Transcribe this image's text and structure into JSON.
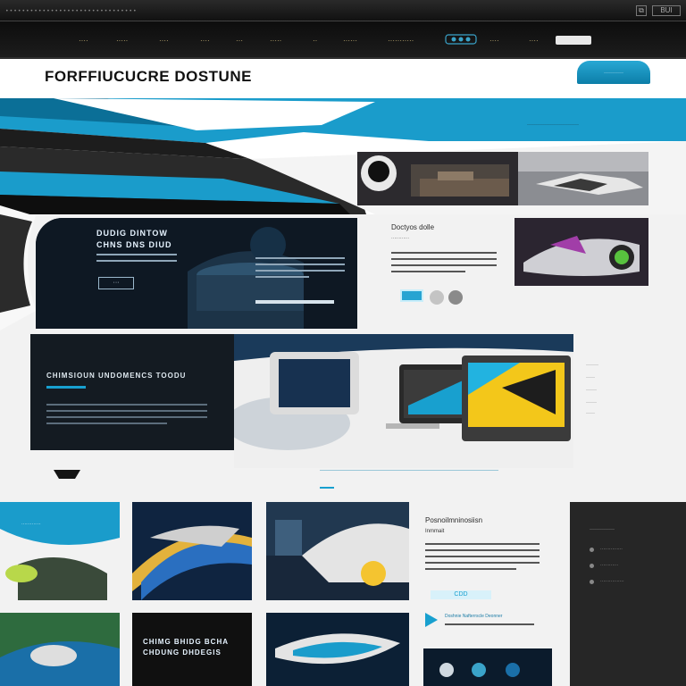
{
  "browser": {
    "url_text": "••••••••••••••••••••••••••••••••",
    "tool_left": "⧉",
    "tool_right": "BUI"
  },
  "nav": {
    "items": [
      "····",
      "·····",
      "····",
      "····",
      "···",
      "·····",
      "··",
      "······",
      "···········",
      "····",
      "····",
      "··"
    ]
  },
  "header": {
    "logo": "FORFFIUCUCRE DOSTUNE",
    "cta_label": "···········"
  },
  "hero": {
    "tagline": "·····························"
  },
  "feature": {
    "title_line1": "DUDIG DINTOW",
    "title_line2": "CHNS DNS DIUD",
    "button_label": "···",
    "side_title": "Doctyos dolle",
    "side_sub": "············"
  },
  "showcase": {
    "title": "CHIMSIOUN UNDOMENCS TOODU",
    "side_labels": [
      "·······",
      "·····",
      "······",
      "······",
      "·····"
    ]
  },
  "gallery": {
    "tile1_caption": "·············",
    "tile5_caption_line1": "CHIMG BHIDG BCHA",
    "tile5_caption_line2": "CHDUNG DHDEGIS"
  },
  "article": {
    "title": "Posnoilmninosiisn",
    "subtitle": "Inmmait",
    "link_label": "CDD",
    "promo": "Doshnie Nafterrscle Deonner"
  },
  "sidebar": {
    "heading": "··············",
    "links": [
      "···············",
      "············",
      "················"
    ]
  },
  "colors": {
    "accent": "#18a0cf",
    "dark": "#0e1823",
    "nav_text": "#c9b77a"
  }
}
